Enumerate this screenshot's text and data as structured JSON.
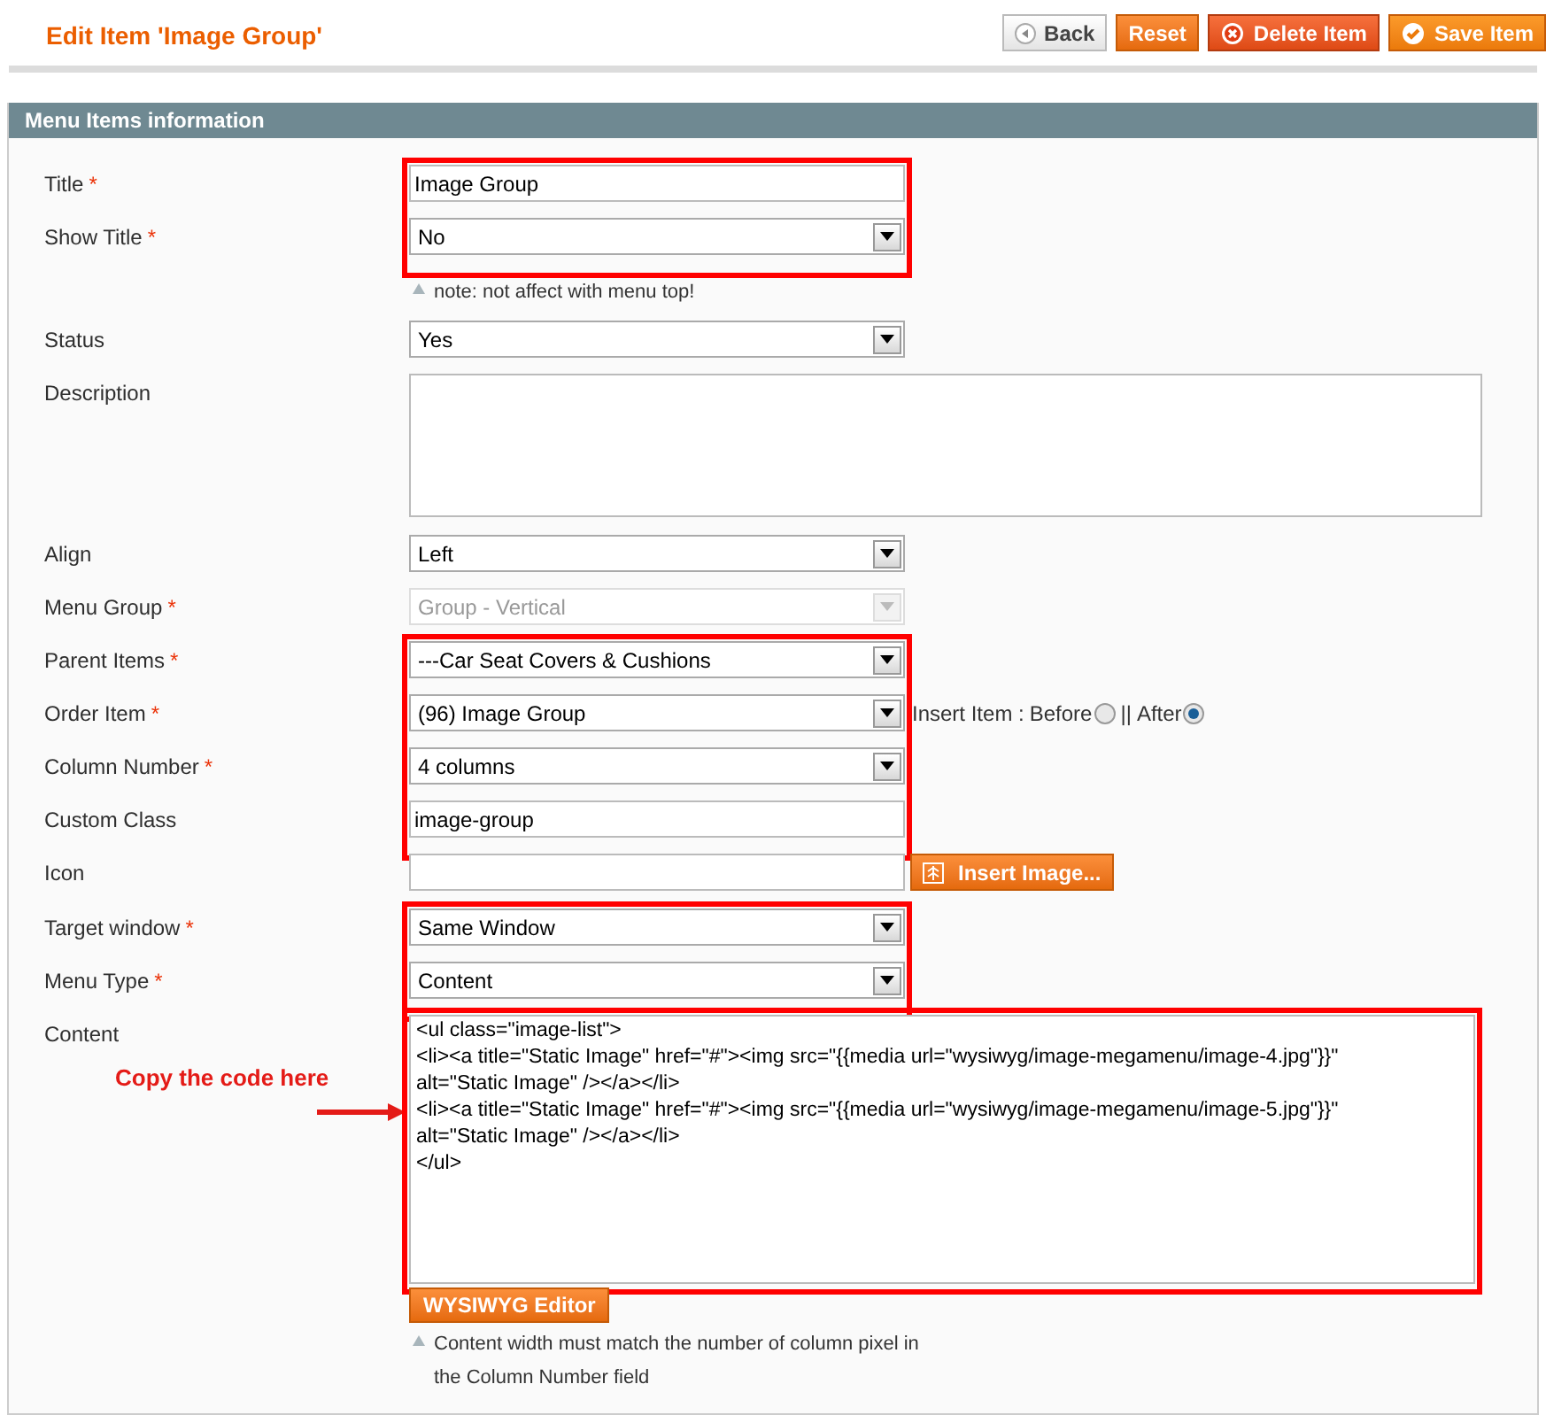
{
  "page_title": "Edit Item 'Image Group'",
  "actions": [
    {
      "label": "Back",
      "kind": "back"
    },
    {
      "label": "Reset",
      "kind": "plain"
    },
    {
      "label": "Delete Item",
      "kind": "delete"
    },
    {
      "label": "Save Item",
      "kind": "save"
    }
  ],
  "panel_title": "Menu Items information",
  "sections": [
    {
      "highlighted": true,
      "fields": [
        {
          "label": "Title",
          "required_mark": "*",
          "kind": "text",
          "value": "Image Group"
        },
        {
          "label": "Show Title",
          "required_mark": "*",
          "kind": "select",
          "value": "No",
          "disabled": false
        }
      ],
      "note": [
        "note: not affect with menu top!"
      ]
    },
    {
      "highlighted": false,
      "fields": [
        {
          "label": "Status",
          "kind": "select",
          "value": "Yes",
          "disabled": false
        },
        {
          "label": "Description",
          "kind": "textarea"
        },
        {
          "label": "Align",
          "kind": "select",
          "value": "Left",
          "disabled": false
        },
        {
          "label": "Menu Group",
          "required_mark": "*",
          "kind": "select",
          "value": "Group - Vertical",
          "disabled": true
        }
      ]
    },
    {
      "highlighted": true,
      "fields": [
        {
          "label": "Parent Items",
          "required_mark": "*",
          "kind": "select",
          "value": "---Car Seat Covers & Cushions",
          "disabled": false
        },
        {
          "label": "Order Item",
          "required_mark": "*",
          "kind": "select",
          "value": "(96) Image Group",
          "disabled": false,
          "insert": {
            "prefix": "Insert Item :",
            "separator": "||",
            "options": [
              {
                "label": "Before",
                "selected": false
              },
              {
                "label": "After",
                "selected": true
              }
            ]
          }
        },
        {
          "label": "Column Number",
          "required_mark": "*",
          "kind": "select",
          "value": "4 columns",
          "disabled": false
        },
        {
          "label": "Custom Class",
          "kind": "text",
          "value": "image-group"
        }
      ]
    },
    {
      "highlighted": false,
      "fields": [
        {
          "label": "Icon",
          "kind": "image",
          "button": "Insert Image..."
        }
      ]
    },
    {
      "highlighted": true,
      "fields": [
        {
          "label": "Target window",
          "required_mark": "*",
          "kind": "select",
          "value": "Same Window",
          "disabled": false
        },
        {
          "label": "Menu Type",
          "required_mark": "*",
          "kind": "select",
          "value": "Content",
          "disabled": false
        }
      ]
    },
    {
      "highlighted": true,
      "fields": [
        {
          "label": "Content",
          "kind": "code",
          "annotation": "Copy the code here",
          "lines": [
            "<ul class=\"image-list\">",
            "<li><a title=\"Static Image\" href=\"#\"><img src=\"{{media url=\"wysiwyg/image-megamenu/image-4.jpg\"}}\"",
            "alt=\"Static Image\" /></a></li>",
            "<li><a title=\"Static Image\" href=\"#\"><img src=\"{{media url=\"wysiwyg/image-megamenu/image-5.jpg\"}}\"",
            "alt=\"Static Image\" /></a></li>",
            "</ul>"
          ]
        }
      ],
      "button": "WYSIWYG Editor",
      "note": [
        "Content width must match the number of column pixel in",
        "the Column Number field"
      ]
    }
  ]
}
